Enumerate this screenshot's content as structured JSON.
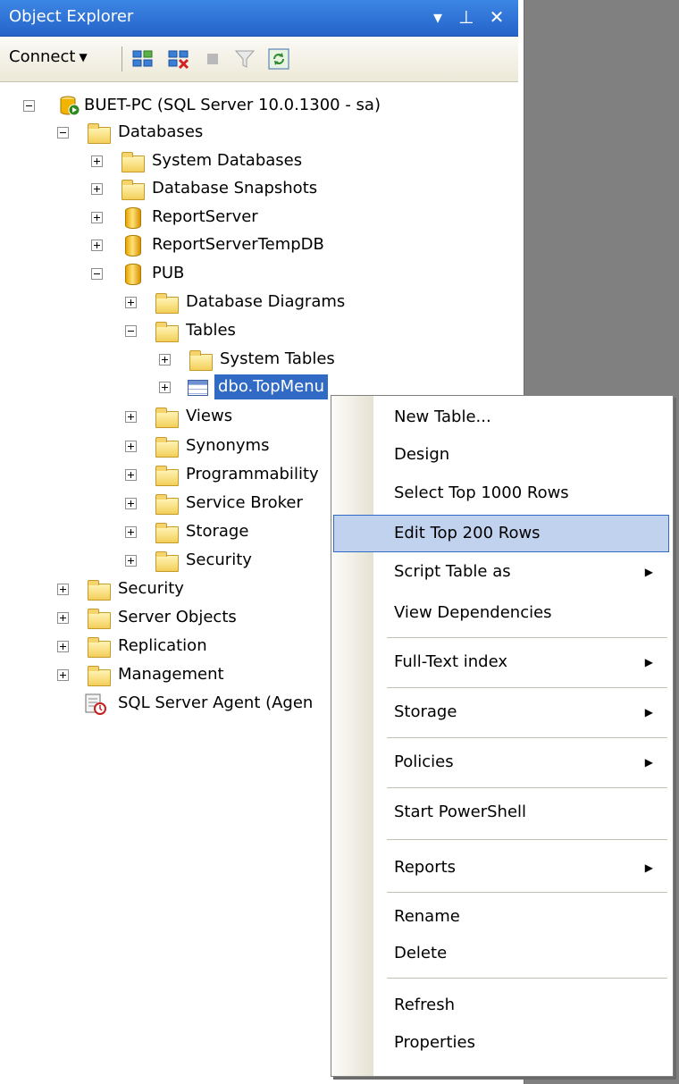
{
  "window": {
    "title": "Object Explorer",
    "buttons": [
      "▾",
      "⊥",
      "✕"
    ]
  },
  "toolbar": {
    "connect_label": "Connect",
    "icons": [
      "connect-object-explorer-icon",
      "disconnect-icon",
      "stop-icon",
      "filter-icon",
      "refresh-icon"
    ]
  },
  "tree": {
    "server": "BUET-PC (SQL Server 10.0.1300 - sa)",
    "databases": "Databases",
    "system_databases": "System Databases",
    "database_snapshots": "Database Snapshots",
    "reportserver": "ReportServer",
    "reportservertempdb": "ReportServerTempDB",
    "pub": "PUB",
    "database_diagrams": "Database Diagrams",
    "tables": "Tables",
    "system_tables": "System Tables",
    "dbo_topmenu": "dbo.TopMenu",
    "views": "Views",
    "synonyms": "Synonyms",
    "programmability": "Programmability",
    "service_broker": "Service Broker",
    "storage": "Storage",
    "security_db": "Security",
    "security": "Security",
    "server_objects": "Server Objects",
    "replication": "Replication",
    "management": "Management",
    "sql_server_agent": "SQL Server Agent (Agen"
  },
  "context_menu": {
    "items": [
      {
        "label": "New Table..."
      },
      {
        "label": "Design"
      },
      {
        "label": "Select Top 1000 Rows"
      },
      {
        "label": "Edit Top 200 Rows",
        "highlighted": true
      },
      {
        "label": "Script Table as",
        "submenu": true
      },
      {
        "label": "View Dependencies"
      },
      {
        "label": "Full-Text index",
        "submenu": true
      },
      {
        "label": "Storage",
        "submenu": true
      },
      {
        "label": "Policies",
        "submenu": true
      },
      {
        "label": "Start PowerShell"
      },
      {
        "label": "Reports",
        "submenu": true
      },
      {
        "label": "Rename"
      },
      {
        "label": "Delete"
      },
      {
        "label": "Refresh"
      },
      {
        "label": "Properties"
      }
    ]
  },
  "colors": {
    "titlebar": "#2f73d6",
    "selection": "#316ac5",
    "menu_highlight": "#c1d2ee"
  }
}
